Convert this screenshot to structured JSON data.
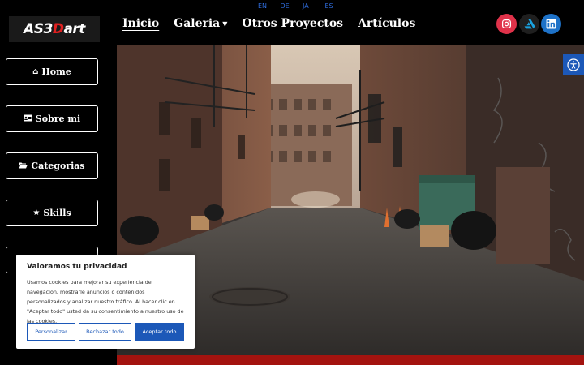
{
  "logo": {
    "prefix": "AS3",
    "accent": "D",
    "suffix": "art"
  },
  "languages": [
    "EN",
    "DE",
    "JA",
    "ES"
  ],
  "nav": {
    "items": [
      {
        "label": "Inicio",
        "active": true
      },
      {
        "label": "Galeria",
        "has_dropdown": true
      },
      {
        "label": "Otros Proyectos"
      },
      {
        "label": "Artículos"
      }
    ]
  },
  "social": [
    {
      "name": "instagram-icon",
      "color": "#e0324a"
    },
    {
      "name": "artstation-icon",
      "color": "#1f1f1f"
    },
    {
      "name": "linkedin-icon",
      "color": "#1e72c8"
    }
  ],
  "sidebar": {
    "items": [
      {
        "label": "Home",
        "icon": "home-icon"
      },
      {
        "label": "Sobre mi",
        "icon": "id-card-icon"
      },
      {
        "label": "Categorias",
        "icon": "folder-open-icon"
      },
      {
        "label": "Skills",
        "icon": "star-icon"
      },
      {
        "label": "",
        "icon": ""
      }
    ]
  },
  "hero": {
    "alt": "",
    "accent_color": "#a3130f"
  },
  "accessibility": {
    "icon": "accessibility-icon",
    "color": "#1c58b8"
  },
  "cookie": {
    "title": "Valoramos tu privacidad",
    "text": "Usamos cookies para mejorar su experiencia de navegación, mostrarle anuncios o contenidos personalizados y analizar nuestro tráfico. Al hacer clic en \"Aceptar todo\" usted da su consentimiento a nuestro uso de las cookies.",
    "customize": "Personalizar",
    "reject": "Rechazar todo",
    "accept": "Aceptar todo"
  }
}
